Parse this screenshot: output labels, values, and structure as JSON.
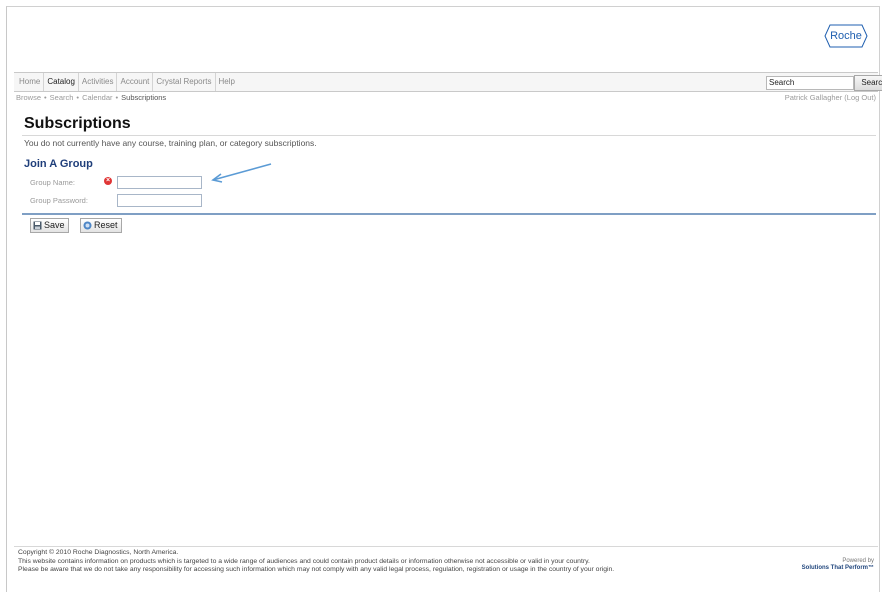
{
  "brand": {
    "logo_text": "Roche"
  },
  "nav": {
    "tabs": [
      {
        "label": "Home",
        "active": false
      },
      {
        "label": "Catalog",
        "active": true
      },
      {
        "label": "Activities",
        "active": false
      },
      {
        "label": "Account",
        "active": false
      },
      {
        "label": "Crystal Reports",
        "active": false
      },
      {
        "label": "Help",
        "active": false
      }
    ],
    "search": {
      "value": "Search",
      "button_label": "Search"
    }
  },
  "breadcrumb": {
    "items": [
      "Browse",
      "Search",
      "Calendar"
    ],
    "current": "Subscriptions",
    "separator": "•"
  },
  "user": {
    "text": "Patrick Gallagher (Log Out)"
  },
  "main": {
    "title": "Subscriptions",
    "intro": "You do not currently have any course, training plan, or category subscriptions.",
    "section_title": "Join A Group",
    "fields": {
      "group_name_label": "Group Name:",
      "group_name_value": "",
      "group_password_label": "Group Password:",
      "group_password_value": ""
    },
    "buttons": {
      "save": "Save",
      "reset": "Reset"
    }
  },
  "footer": {
    "copyright": "Copyright © 2010 Roche Diagnostics, North America.",
    "line1": "This website contains information on products which is targeted to a wide range of audiences and could contain product details or information otherwise not accessible or valid in your country.",
    "line2": "Please be aware that we do not take any responsibility for accessing such information which may not comply with any valid legal process, regulation, registration or usage in the country of your origin.",
    "powered_by": "Powered by",
    "powered_brand": "Solutions That Perform™"
  },
  "colors": {
    "accent": "#1f3e7a",
    "rule": "#7f9fc4",
    "required": "#e03535",
    "arrow": "#5b9bd5"
  },
  "icons": {
    "required": "x-circle-icon",
    "save": "floppy-disk-icon",
    "reset": "refresh-icon",
    "annotation": "arrow-icon"
  }
}
